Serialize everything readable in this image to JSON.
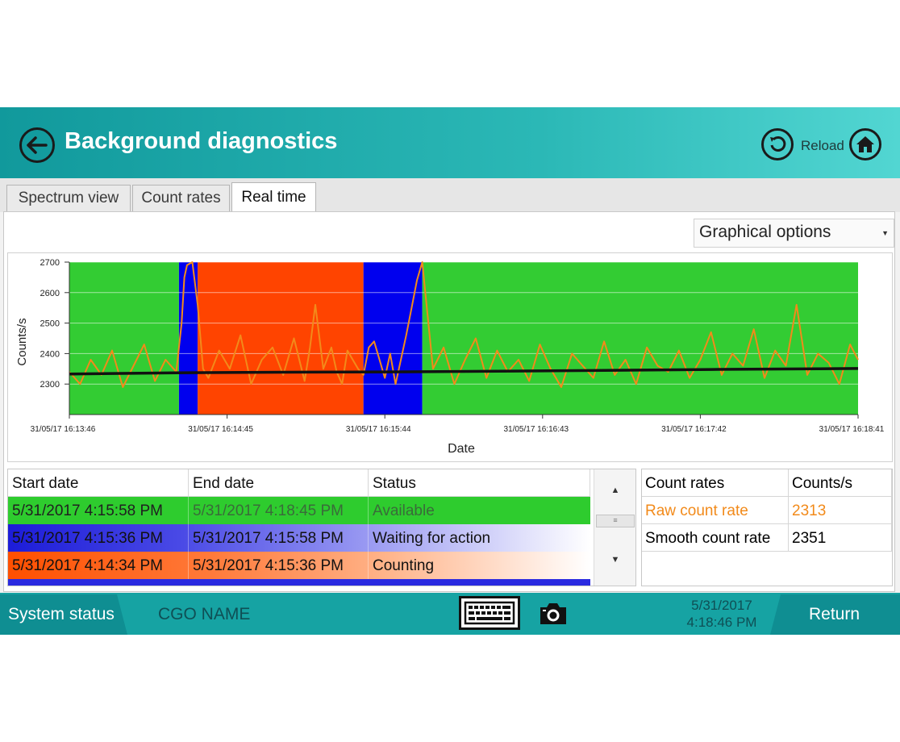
{
  "header": {
    "title": "Background diagnostics",
    "reload_label": "Reload"
  },
  "tabs": [
    {
      "label": "Spectrum view",
      "active": false
    },
    {
      "label": "Count rates",
      "active": false
    },
    {
      "label": "Real time",
      "active": true
    }
  ],
  "graphical_options": {
    "label": "Graphical options"
  },
  "chart_data": {
    "type": "line",
    "xlabel": "Date",
    "ylabel": "Counts/s",
    "ylim": [
      2200,
      2700
    ],
    "yticks": [
      2300,
      2400,
      2500,
      2600,
      2700
    ],
    "xtick_labels": [
      "31/05/17 16:13:46",
      "31/05/17 16:14:45",
      "31/05/17 16:15:44",
      "31/05/17 16:16:43",
      "31/05/17 16:17:42",
      "31/05/17 16:18:41"
    ],
    "x_range_seconds": [
      0,
      295
    ],
    "grid": true,
    "status_bands": [
      {
        "status": "Available",
        "color": "#33cc33",
        "start_s": 0,
        "end_s": 41
      },
      {
        "status": "Waiting for action",
        "color": "#0000ee",
        "start_s": 41,
        "end_s": 48
      },
      {
        "status": "Counting",
        "color": "#ff4400",
        "start_s": 48,
        "end_s": 110
      },
      {
        "status": "Waiting for action",
        "color": "#0000ee",
        "start_s": 110,
        "end_s": 132
      },
      {
        "status": "Available",
        "color": "#33cc33",
        "start_s": 132,
        "end_s": 295
      }
    ],
    "series": [
      {
        "color": "#f28a1a",
        "x": [
          0,
          4,
          8,
          12,
          16,
          20,
          24,
          28,
          32,
          36,
          40,
          42,
          43,
          44,
          46,
          48,
          50,
          52,
          56,
          60,
          64,
          68,
          72,
          76,
          80,
          84,
          88,
          90,
          92,
          95,
          98,
          100,
          102,
          104,
          106,
          108,
          110,
          112,
          114,
          116,
          118,
          120,
          122,
          124,
          126,
          128,
          130,
          132,
          136,
          140,
          144,
          148,
          152,
          156,
          160,
          164,
          168,
          172,
          176,
          180,
          184,
          188,
          192,
          196,
          200,
          204,
          208,
          212,
          216,
          220,
          224,
          228,
          232,
          236,
          240,
          244,
          248,
          252,
          256,
          260,
          264,
          268,
          272,
          276,
          280,
          284,
          288,
          292,
          295
        ],
        "y": [
          2340,
          2300,
          2380,
          2330,
          2410,
          2290,
          2360,
          2430,
          2310,
          2380,
          2340,
          2500,
          2650,
          2690,
          2700,
          2560,
          2350,
          2320,
          2410,
          2350,
          2460,
          2300,
          2380,
          2420,
          2330,
          2450,
          2310,
          2420,
          2560,
          2350,
          2420,
          2340,
          2300,
          2410,
          2380,
          2350,
          2330,
          2420,
          2440,
          2380,
          2320,
          2400,
          2300,
          2380,
          2460,
          2550,
          2640,
          2700,
          2350,
          2420,
          2300,
          2380,
          2450,
          2320,
          2410,
          2340,
          2380,
          2310,
          2430,
          2350,
          2290,
          2400,
          2360,
          2320,
          2440,
          2330,
          2380,
          2300,
          2420,
          2360,
          2340,
          2410,
          2320,
          2380,
          2470,
          2330,
          2400,
          2360,
          2480,
          2320,
          2410,
          2360,
          2560,
          2330,
          2400,
          2370,
          2300,
          2430,
          2380
        ]
      },
      {
        "color": "#111111",
        "x": [
          0,
          40,
          80,
          120,
          160,
          200,
          240,
          280,
          295
        ],
        "y": [
          2333,
          2337,
          2339,
          2340,
          2342,
          2345,
          2348,
          2350,
          2351
        ]
      }
    ]
  },
  "status_table": {
    "headers": [
      "Start date",
      "End date",
      "Status"
    ],
    "rows": [
      {
        "start": "5/31/2017 4:15:58 PM",
        "end": "5/31/2017 4:18:45 PM",
        "status": "Available"
      },
      {
        "start": "5/31/2017 4:15:36 PM",
        "end": "5/31/2017 4:15:58 PM",
        "status": "Waiting for action"
      },
      {
        "start": "5/31/2017 4:14:34 PM",
        "end": "5/31/2017 4:15:36 PM",
        "status": "Counting"
      }
    ]
  },
  "rates_table": {
    "headers": [
      "Count rates",
      "Counts/s"
    ],
    "rows": [
      {
        "label": "Raw count rate",
        "value": "2313"
      },
      {
        "label": "Smooth count rate",
        "value": "2351"
      }
    ]
  },
  "footer": {
    "system_status": "System status",
    "cgo_name": "CGO NAME",
    "date": "5/31/2017",
    "time": "4:18:46 PM",
    "return_label": "Return"
  },
  "icons": {
    "back": "arrow-left-icon",
    "reload": "reload-icon",
    "home": "home-icon",
    "keyboard": "keyboard-icon",
    "camera": "camera-icon"
  }
}
